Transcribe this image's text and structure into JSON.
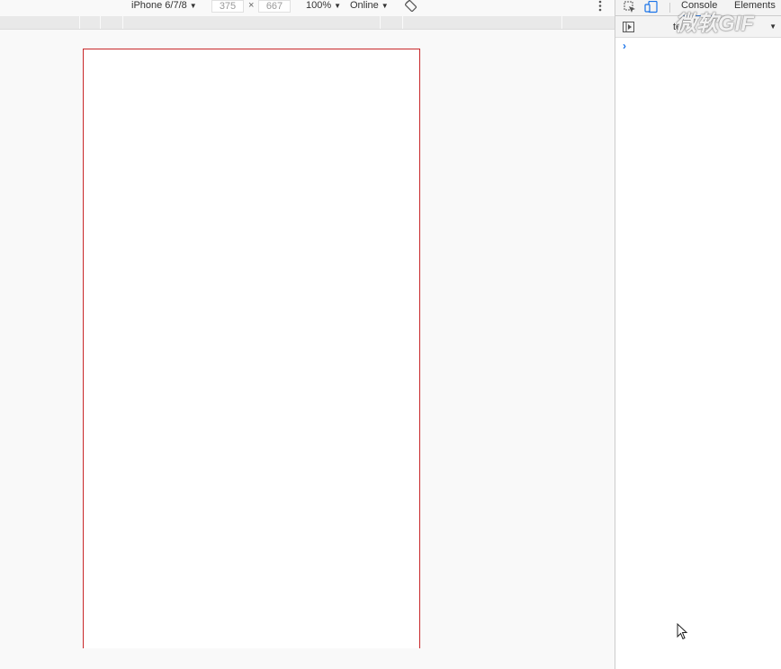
{
  "device_toolbar": {
    "device": "iPhone 6/7/8",
    "width": "375",
    "times": "×",
    "height": "667",
    "zoom": "100%",
    "network": "Online",
    "dropdown_arrow": "▼"
  },
  "devtools": {
    "tabs": [
      "Console",
      "Elements"
    ],
    "active_tab": "Console",
    "context": "te",
    "watermark": "微软GIF",
    "prompt": "›"
  },
  "colors": {
    "frame_border": "#c8282a",
    "accent": "#1a73e8"
  }
}
